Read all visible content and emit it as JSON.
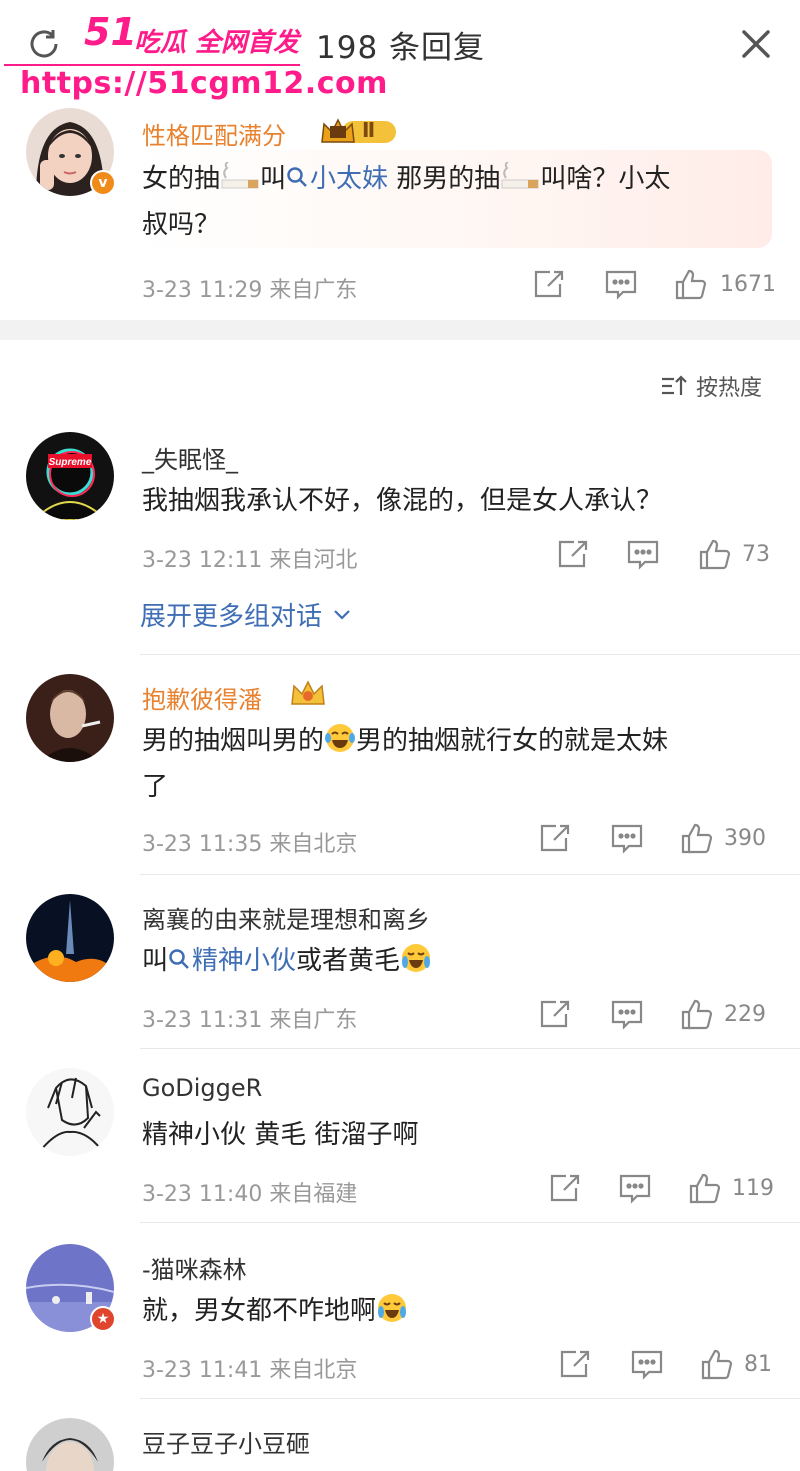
{
  "header": {
    "title": "198 条回复",
    "watermark_brand": "51",
    "watermark_slogan": "吃瓜 全网首发",
    "watermark_url": "https://51cgm12.com"
  },
  "main_post": {
    "username": "性格匹配满分",
    "level_badge": "Ⅱ",
    "verified_badge": "v",
    "text_part1": "女的抽",
    "text_part2": "叫",
    "topic": "小太妹",
    "text_part3": " 那男的抽",
    "text_part4": "叫啥？小太",
    "text_line2": "叔吗？",
    "timestamp": "3-23 11:29",
    "location": "来自广东",
    "likes": "1671"
  },
  "sort_label": "按热度",
  "expand_label": "展开更多组对话",
  "comments": [
    {
      "username": "_失眠怪_",
      "avatar_text": "Supreme",
      "text": "我抽烟我承认不好，像混的，但是女人承认？",
      "timestamp": "3-23 12:11",
      "location": "来自河北",
      "likes": "73"
    },
    {
      "username": "抱歉彼得潘",
      "text_part1": "男的抽烟叫男的",
      "text_part2": "男的抽烟就行女的就是太妹",
      "text_line2": "了",
      "timestamp": "3-23 11:35",
      "location": "来自北京",
      "likes": "390"
    },
    {
      "username": "离襄的由来就是理想和离乡",
      "text_part1": "叫",
      "topic": "精神小伙",
      "text_part2": "或者黄毛",
      "timestamp": "3-23 11:31",
      "location": "来自广东",
      "likes": "229"
    },
    {
      "username": "GoDiggeR",
      "text": "精神小伙 黄毛 街溜子啊",
      "timestamp": "3-23 11:40",
      "location": "来自福建",
      "likes": "119"
    },
    {
      "username": "-猫咪森林",
      "text_part1": "就，男女都不咋地啊",
      "timestamp": "3-23 11:41",
      "location": "来自北京",
      "likes": "81"
    },
    {
      "username": "豆子豆子小豆砸"
    }
  ],
  "colors": {
    "username_vip": "#e8822f",
    "link": "#3f6eb5",
    "meta": "#999999",
    "separator": "#f2f2f2"
  }
}
